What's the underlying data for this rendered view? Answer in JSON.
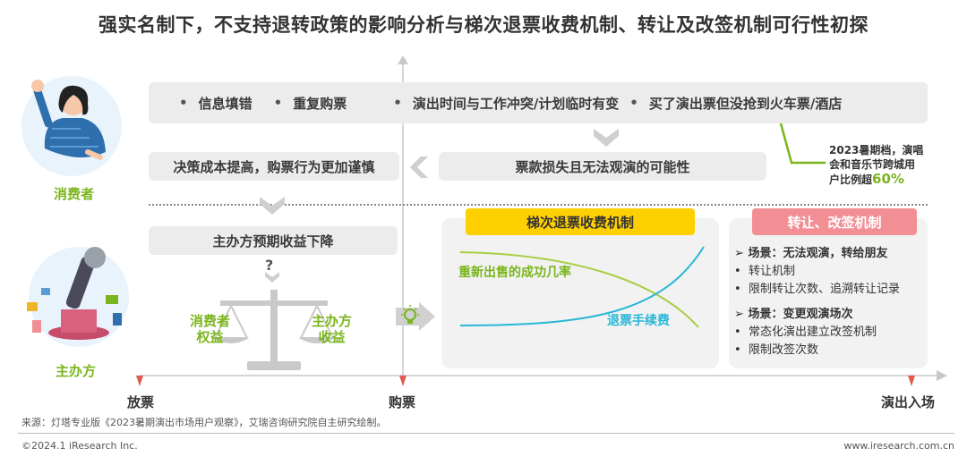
{
  "title": "强实名制下，不支持退转政策的影响分析与梯次退票收费机制、转让及改签机制可行性初探",
  "top_items": [
    "信息填错",
    "重复购票",
    "演出时间与工作冲突/计划临时有变",
    "买了演出票但没抢到火车票/酒店"
  ],
  "bullet": "•",
  "loss_box": "票款损失且无法观演的可能性",
  "decision_box": "决策成本提高，购票行为更加谨慎",
  "organizer_box": "主办方预期收益下降",
  "question": "?",
  "stat": {
    "line1": "2023暑期档，演唱",
    "line2": "会和音乐节跨城用",
    "line3_prefix": "户比例超",
    "value": "60%"
  },
  "consumer_label": "消费者",
  "organizer_label": "主办方",
  "scale_left": {
    "line1": "消费者",
    "line2": "权益"
  },
  "scale_right": {
    "line1": "主办方",
    "line2": "收益"
  },
  "tier_title": "梯次退票收费机制",
  "curve_resale": "重新出售的成功几率",
  "curve_fee": "退票手续费",
  "transfer_title": "转让、改签机制",
  "transfer_list": [
    {
      "type": "head",
      "mark": "➢",
      "text": "场景：无法观演，转给朋友"
    },
    {
      "type": "item",
      "mark": "•",
      "text": "转让机制"
    },
    {
      "type": "item",
      "mark": "•",
      "text": "限制转让次数、追溯转让记录"
    },
    {
      "type": "head",
      "mark": "➢",
      "text": "场景：变更观演场次"
    },
    {
      "type": "item",
      "mark": "•",
      "text": "常态化演出建立改签机制"
    },
    {
      "type": "item",
      "mark": "•",
      "text": "限制改签次数"
    }
  ],
  "axis": {
    "start": "放票",
    "mid": "购票",
    "end": "演出入场"
  },
  "source": "来源：灯塔专业版《2023暑期演出市场用户观察》，艾瑞咨询研究院自主研究绘制。",
  "copyright": "©2024.1 iResearch Inc.",
  "website": "www.iresearch.com.cn",
  "colors": {
    "green": "#7ab51d",
    "blue": "#29b6d6",
    "yellow": "#ffd000",
    "pink": "#f28f94",
    "red": "#e05a4e",
    "gray": "#ececec"
  }
}
